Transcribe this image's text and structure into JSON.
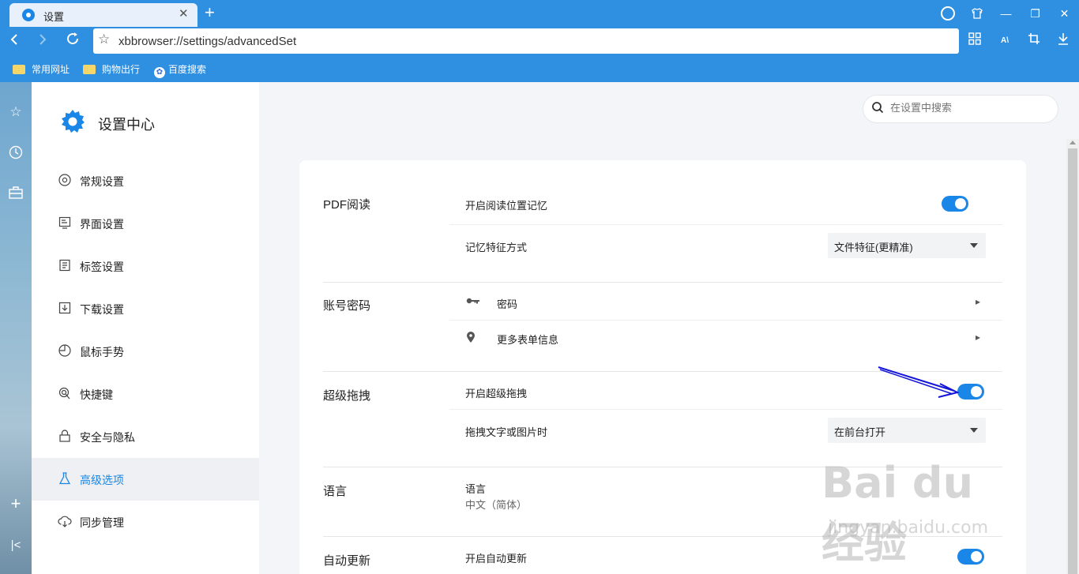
{
  "tab": {
    "title": "设置",
    "close": "✕",
    "new_tab": "+"
  },
  "url": {
    "value": "xbbrowser://settings/advancedSet"
  },
  "bookmarks": [
    {
      "label": "常用网址",
      "icon": "folder-icon"
    },
    {
      "label": "购物出行",
      "icon": "folder-icon"
    },
    {
      "label": "百度搜索",
      "icon": "baidu-paw-icon"
    }
  ],
  "sidebar": {
    "title": "设置中心",
    "items": [
      {
        "label": "常规设置",
        "icon": "general-icon"
      },
      {
        "label": "界面设置",
        "icon": "interface-icon"
      },
      {
        "label": "标签设置",
        "icon": "tab-icon"
      },
      {
        "label": "下载设置",
        "icon": "download-icon"
      },
      {
        "label": "鼠标手势",
        "icon": "mouse-icon"
      },
      {
        "label": "快捷键",
        "icon": "shortcut-icon"
      },
      {
        "label": "安全与隐私",
        "icon": "lock-icon"
      },
      {
        "label": "高级选项",
        "icon": "flask-icon",
        "active": true
      },
      {
        "label": "同步管理",
        "icon": "cloud-sync-icon"
      }
    ]
  },
  "search": {
    "placeholder": "在设置中搜索"
  },
  "sections": {
    "pdf": {
      "title": "PDF阅读",
      "remember_label": "开启阅读位置记忆",
      "remember_on": true,
      "mode_label": "记忆特征方式",
      "mode_value": "文件特征(更精准)"
    },
    "account": {
      "title": "账号密码",
      "password_label": "密码",
      "forms_label": "更多表单信息"
    },
    "drag": {
      "title": "超级拖拽",
      "enable_label": "开启超级拖拽",
      "enable_on": true,
      "when_label": "拖拽文字或图片时",
      "when_value": "在前台打开"
    },
    "language": {
      "title": "语言",
      "label": "语言",
      "value": "中文（简体）"
    },
    "update": {
      "title": "自动更新",
      "enable_label": "开启自动更新",
      "enable_on": true
    }
  },
  "watermark": {
    "logo": "Bai du 经验",
    "url": "jingyan.baidu.com"
  },
  "colors": {
    "accent": "#1a86e8",
    "titlebar": "#2f8fe0",
    "annotation_arrow": "#1515d8"
  }
}
